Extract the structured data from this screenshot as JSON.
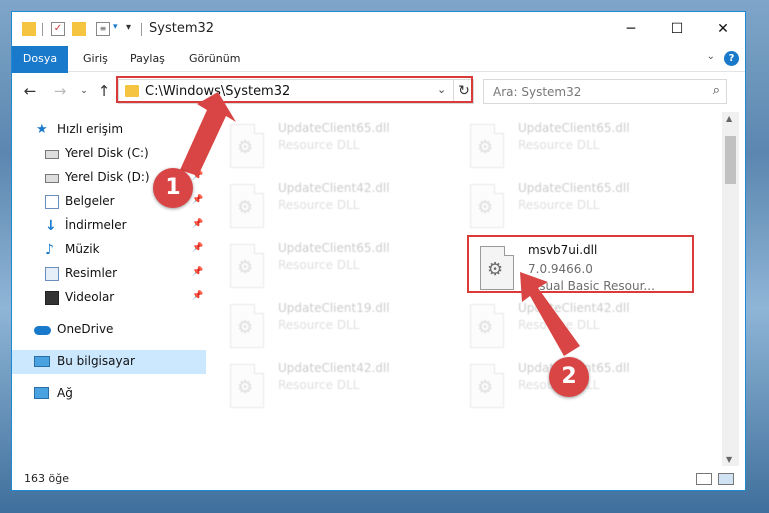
{
  "window": {
    "title": "System32"
  },
  "ribbon": {
    "tabs": [
      "Dosya",
      "Giriş",
      "Paylaş",
      "Görünüm"
    ]
  },
  "nav": {
    "address": "C:\\Windows\\System32",
    "search_placeholder": "Ara: System32"
  },
  "sidebar": {
    "items": [
      {
        "label": "Hızlı erişim"
      },
      {
        "label": "Yerel Disk (C:)"
      },
      {
        "label": "Yerel Disk (D:)"
      },
      {
        "label": "Belgeler"
      },
      {
        "label": "İndirmeler"
      },
      {
        "label": "Müzik"
      },
      {
        "label": "Resimler"
      },
      {
        "label": "Videolar"
      },
      {
        "label": "OneDrive"
      },
      {
        "label": "Bu bilgisayar"
      },
      {
        "label": "Ağ"
      }
    ]
  },
  "files": [
    {
      "name": "UpdateClient65.dll",
      "line2": "Resource DLL"
    },
    {
      "name": "UpdateClient65.dll",
      "line2": "Resource DLL"
    },
    {
      "name": "UpdateClient42.dll",
      "line2": "Resource DLL"
    },
    {
      "name": "UpdateClient65.dll",
      "line2": "Resource DLL"
    },
    {
      "name": "UpdateClient65.dll",
      "line2": "Resource DLL"
    },
    {
      "name": "msvb7ui.dll",
      "line2": "7.0.9466.0",
      "line3": "Visual Basic Resour..."
    },
    {
      "name": "UpdateClient19.dll",
      "line2": "Resource DLL"
    },
    {
      "name": "UpdateClient42.dll",
      "line2": "Resource DLL"
    },
    {
      "name": "UpdateClient42.dll",
      "line2": "Resource DLL"
    },
    {
      "name": "UpdateClient65.dll",
      "line2": "Resource DLL"
    }
  ],
  "status": {
    "count": "163 öğe"
  },
  "annotations": {
    "step1": "1",
    "step2": "2"
  }
}
